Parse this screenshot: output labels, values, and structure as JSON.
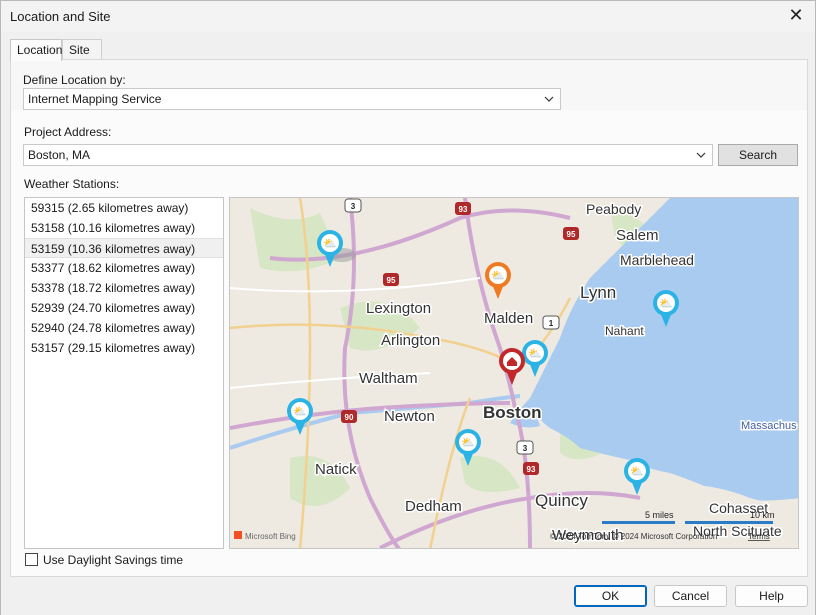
{
  "window": {
    "title": "Location and Site"
  },
  "tabs": [
    {
      "label": "Location"
    },
    {
      "label": "Site"
    }
  ],
  "define_location": {
    "label": "Define Location by:",
    "value": "Internet Mapping Service"
  },
  "project_address": {
    "label": "Project Address:",
    "value": "Boston, MA",
    "search_label": "Search"
  },
  "weather": {
    "label": "Weather Stations:",
    "stations": [
      "59315 (2.65 kilometres away)",
      "53158 (10.16 kilometres away)",
      "53159 (10.36 kilometres away)",
      "53377 (18.62 kilometres away)",
      "53378 (18.72 kilometres away)",
      "52939 (24.70 kilometres away)",
      "52940 (24.78 kilometres away)",
      "53157 (29.15 kilometres away)"
    ],
    "selected_index": 2
  },
  "map": {
    "places": [
      "Peabody",
      "Salem",
      "Marblehead",
      "Lynn",
      "Nahant",
      "Lexington",
      "Malden",
      "Arlington",
      "Waltham",
      "Newton",
      "Boston",
      "Natick",
      "Dedham",
      "Quincy",
      "Weymouth",
      "Cohasset",
      "North Scituate",
      "Massachus"
    ],
    "shields": [
      "3",
      "93",
      "95",
      "95",
      "1",
      "90",
      "3",
      "93"
    ],
    "scale_miles": "5 miles",
    "scale_km": "10 km",
    "copyright": "© 2024 TomTom, © 2024 Microsoft Corporation",
    "terms": "Terms",
    "logo": "Microsoft Bing",
    "colors": {
      "water": "#a9cbef",
      "land": "#eeeae1",
      "highway": "#cfa7d1",
      "home_pin": "#c0282c",
      "selected_pin": "#f07a22",
      "station_pin": "#2bb3e6"
    }
  },
  "daylight": {
    "label": "Use Daylight Savings time",
    "checked": false
  },
  "buttons": {
    "ok": "OK",
    "cancel": "Cancel",
    "help": "Help"
  }
}
